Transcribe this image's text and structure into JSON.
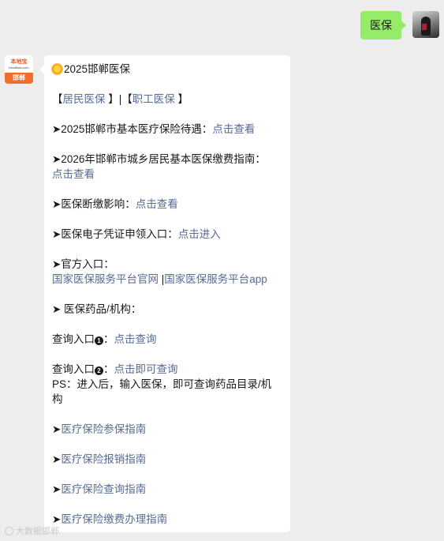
{
  "outgoing": {
    "text": "医保"
  },
  "incoming": {
    "avatar": {
      "logo_top": "本地宝",
      "logo_sub": "bendibao.com",
      "logo_city": "邯郸"
    },
    "title": "2025邯郸医保",
    "tabs": {
      "open1": "【",
      "resident": "居民医保",
      "close1": " 】",
      "sep": "|",
      "open2": "【",
      "employee": "职工医保",
      "close2": " 】"
    },
    "items": [
      {
        "prefix": "➤2025邯郸市基本医疗保险待遇：",
        "link": "点击查看"
      },
      {
        "prefix": "➤2026年邯郸市城乡居民基本医保缴费指南：",
        "link": "点击查看"
      },
      {
        "prefix": "➤医保断缴影响：",
        "link": "点击查看"
      },
      {
        "prefix": "➤医保电子凭证申领入口：",
        "link": "点击进入"
      }
    ],
    "official": {
      "label": "➤官方入口：",
      "link1": "国家医保服务平台官网",
      "sep": " |",
      "link2": "国家医保服务平台app"
    },
    "drugs_label": "➤ 医保药品/机构：",
    "query1": {
      "prefix": "查询入口",
      "badge": "1",
      "colon": "：",
      "link": "点击查询"
    },
    "query2": {
      "prefix": "查询入口",
      "badge": "2",
      "colon": "：",
      "link": "点击即可查询"
    },
    "ps": {
      "line1": "PS：进入后，输入医保，即可查询药品目录/机",
      "line2": "构"
    },
    "guides": [
      {
        "arrow": "➤",
        "link": "医疗保险参保指南"
      },
      {
        "arrow": "➤",
        "link": "医疗保险报销指南"
      },
      {
        "arrow": "➤",
        "link": "医疗保险查询指南"
      },
      {
        "arrow": "➤",
        "link": "医疗保险缴费办理指南"
      }
    ]
  },
  "watermark": "大数据邯郸"
}
